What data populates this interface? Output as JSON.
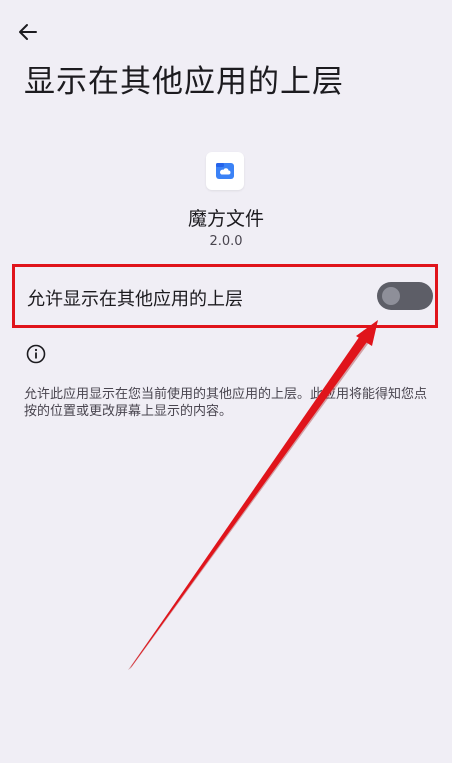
{
  "header": {
    "back_icon": "arrow-back-icon",
    "title": "显示在其他应用的上层"
  },
  "app": {
    "icon": "folder-cloud-icon",
    "icon_color": "#3b82f6",
    "name": "魔方文件",
    "version": "2.0.0"
  },
  "permission": {
    "label": "允许显示在其他应用的上层",
    "enabled": false
  },
  "info": {
    "icon": "info-icon",
    "description": "允许此应用显示在您当前使用的其他应用的上层。此应用将能得知您点按的位置或更改屏幕上显示的内容。"
  },
  "colors": {
    "background": "#f0eef5",
    "highlight": "#e0141b",
    "switch_track": "#5d5e67"
  }
}
